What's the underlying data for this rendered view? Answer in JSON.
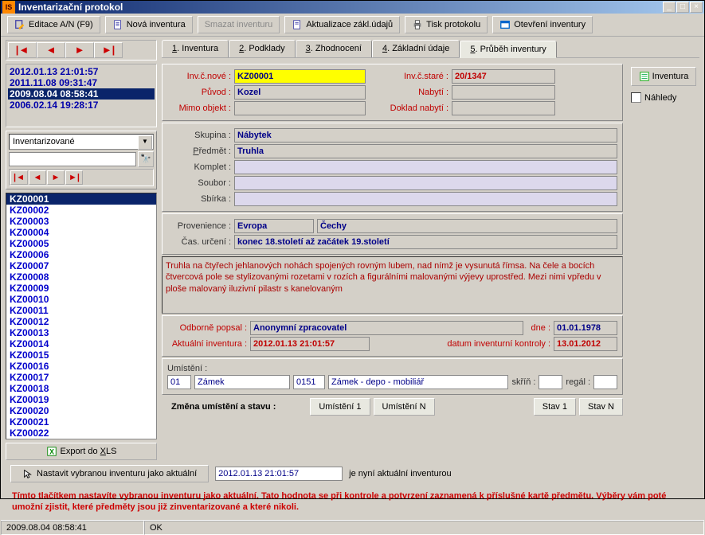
{
  "window": {
    "title": "Inventarizační protokol"
  },
  "toolbar": {
    "editace": "Editace A/N (F9)",
    "nova": "Nová inventura",
    "smazat": "Smazat inventuru",
    "aktualizace": "Aktualizace zákl.údajů",
    "tisk": "Tisk protokolu",
    "otevreni": "Otevření inventury"
  },
  "tabs": {
    "t1": "1. Inventura",
    "t2": "2. Podklady",
    "t3": "3. Zhodnocení",
    "t4": "4. Základní údaje",
    "t5": "5. Průběh inventury"
  },
  "dateList": [
    "2012.01.13 21:01:57",
    "2011.11.08 09:31:47",
    "2009.08.04 08:58:41",
    "2006.02.14 19:28:17"
  ],
  "dateSelected": 2,
  "filterCombo": "Inventarizované",
  "items": [
    "KZ00001",
    "KZ00002",
    "KZ00003",
    "KZ00004",
    "KZ00005",
    "KZ00006",
    "KZ00007",
    "KZ00008",
    "KZ00009",
    "KZ00010",
    "KZ00011",
    "KZ00012",
    "KZ00013",
    "KZ00014",
    "KZ00015",
    "KZ00016",
    "KZ00017",
    "KZ00018",
    "KZ00019",
    "KZ00020",
    "KZ00021",
    "KZ00022"
  ],
  "itemSelected": 0,
  "form": {
    "labels": {
      "inv_nove": "Inv.č.nové :",
      "inv_stare": "Inv.č.staré :",
      "puvod": "Původ :",
      "nabyti": "Nabytí :",
      "mimo": "Mimo objekt :",
      "doklad": "Doklad nabytí :",
      "skupina": "Skupina :",
      "predmet": "Předmět :",
      "komplet": "Komplet :",
      "soubor": "Soubor :",
      "sbirka": "Sbírka :",
      "provenience": "Provenience :",
      "cas": "Čas. určení :",
      "odborne": "Odborně popsal :",
      "dne": "dne :",
      "aktualni": "Aktuální inventura :",
      "datum_kontroly": "datum inventurní kontroly :",
      "umisteni": "Umístění :",
      "skrin": "skříň :",
      "regal": "regál :"
    },
    "inv_nove": "KZ00001",
    "inv_stare": "20/1347",
    "puvod": "Kozel",
    "nabyti": "",
    "mimo": "",
    "doklad": "",
    "skupina": "Nábytek",
    "predmet": "Truhla",
    "komplet": "",
    "soubor": "",
    "sbirka": "",
    "prov1": "Evropa",
    "prov2": "Čechy",
    "cas": "konec 18.století až začátek 19.století",
    "popis": "Truhla na čtyřech jehlanových nohách spojených rovným lubem, nad nímž je vysunutá římsa. Na čele a bocích čtvercová pole se stylizovanými rozetami v rozích a figurálními malovanými výjevy uprostřed. Mezi nimi vpředu v ploše malovaný iluzivní pilastr s kanelovaným",
    "odborne": "Anonymní zpracovatel",
    "dne": "01.01.1978",
    "aktualni": "2012.01.13 21:01:57",
    "datum_kontroly": "13.01.2012",
    "loc1": "01",
    "loc2": "Zámek",
    "loc3": "0151",
    "loc4": "Zámek - depo - mobiliář",
    "skrin": "",
    "regal": ""
  },
  "buttons": {
    "export": "Export do XLS",
    "zmena": "Změna umístění a stavu :",
    "umisteni1": "Umístění 1",
    "umisteniN": "Umístění N",
    "stav1": "Stav 1",
    "stavN": "Stav N",
    "nastavit": "Nastavit vybranou inventuru jako aktuální",
    "aktualni_value": "2012.01.13 21:01:57",
    "aktualni_suffix": "je nyní aktuální inventurou"
  },
  "side": {
    "inventura": "Inventura",
    "nahled": "Náhledy"
  },
  "help": "Tímto tlačítkem nastavíte vybranou inventuru jako aktuální. Tato hodnota se při kontrole a potvrzení zaznamená k příslušné kartě předmětu. Výběry vám poté umožní zjistit, které předměty jsou již zinventarizované a které nikoli.",
  "status": {
    "left": "2009.08.04 08:58:41",
    "ok": "OK"
  }
}
